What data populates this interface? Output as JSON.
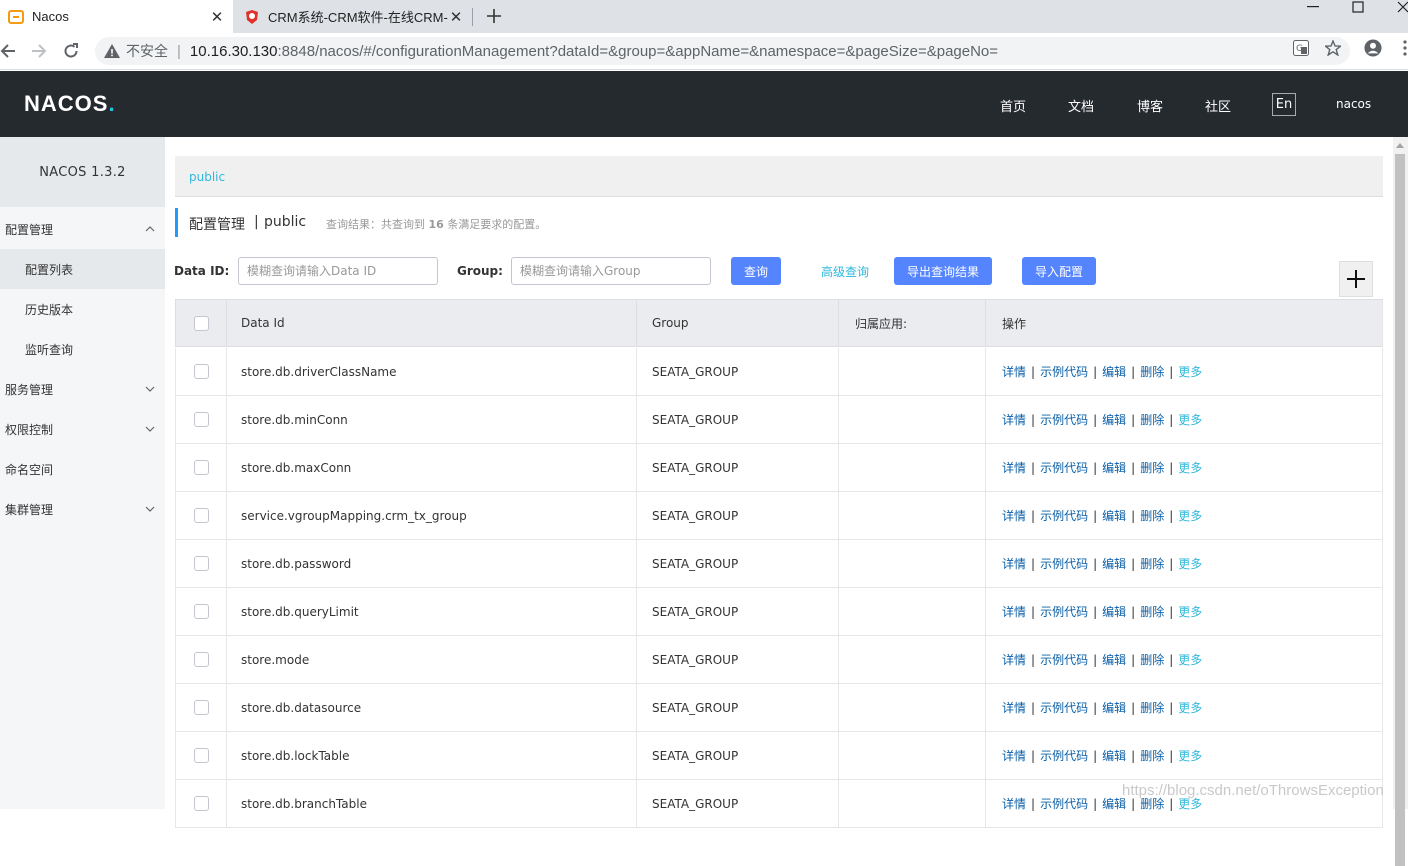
{
  "browser": {
    "tabs": [
      {
        "title": "Nacos",
        "active": true
      },
      {
        "title": "CRM系统-CRM软件-在线CRM-",
        "active": false
      }
    ],
    "address": {
      "security_label": "不安全",
      "host": "10.16.30.130",
      "path": ":8848/nacos/#/configurationManagement?dataId=&group=&appName=&namespace=&pageSize=&pageNo="
    }
  },
  "header": {
    "logo": "NACOS",
    "logo_dot": ".",
    "nav": [
      "首页",
      "文档",
      "博客",
      "社区"
    ],
    "lang": "En",
    "user": "nacos"
  },
  "sidebar": {
    "version": "NACOS 1.3.2",
    "items": [
      {
        "label": "配置管理",
        "level": "top",
        "expanded": true
      },
      {
        "label": "配置列表",
        "level": "sub",
        "selected": true
      },
      {
        "label": "历史版本",
        "level": "sub"
      },
      {
        "label": "监听查询",
        "level": "sub"
      },
      {
        "label": "服务管理",
        "level": "top",
        "expanded": false
      },
      {
        "label": "权限控制",
        "level": "top",
        "expanded": false
      },
      {
        "label": "命名空间",
        "level": "top"
      },
      {
        "label": "集群管理",
        "level": "top",
        "expanded": false
      }
    ]
  },
  "main": {
    "namespace_tab": "public",
    "page_title": "配置管理",
    "title_separator": "|",
    "page_namespace": "public",
    "result_prefix": "查询结果：共查询到",
    "result_count": "16",
    "result_suffix": "条满足要求的配置。",
    "filters": {
      "data_id_label": "Data ID:",
      "data_id_placeholder": "模糊查询请输入Data ID",
      "group_label": "Group:",
      "group_placeholder": "模糊查询请输入Group"
    },
    "buttons": {
      "search": "查询",
      "advanced": "高级查询",
      "export": "导出查询结果",
      "import": "导入配置"
    },
    "table": {
      "columns": [
        "Data Id",
        "Group",
        "归属应用:",
        "操作"
      ],
      "actions": [
        "详情",
        "示例代码",
        "编辑",
        "删除",
        "更多"
      ],
      "rows": [
        {
          "data_id": "store.db.driverClassName",
          "group": "SEATA_GROUP",
          "app": ""
        },
        {
          "data_id": "store.db.minConn",
          "group": "SEATA_GROUP",
          "app": ""
        },
        {
          "data_id": "store.db.maxConn",
          "group": "SEATA_GROUP",
          "app": ""
        },
        {
          "data_id": "service.vgroupMapping.crm_tx_group",
          "group": "SEATA_GROUP",
          "app": ""
        },
        {
          "data_id": "store.db.password",
          "group": "SEATA_GROUP",
          "app": ""
        },
        {
          "data_id": "store.db.queryLimit",
          "group": "SEATA_GROUP",
          "app": ""
        },
        {
          "data_id": "store.mode",
          "group": "SEATA_GROUP",
          "app": ""
        },
        {
          "data_id": "store.db.datasource",
          "group": "SEATA_GROUP",
          "app": ""
        },
        {
          "data_id": "store.db.lockTable",
          "group": "SEATA_GROUP",
          "app": ""
        },
        {
          "data_id": "store.db.branchTable",
          "group": "SEATA_GROUP",
          "app": ""
        }
      ]
    }
  },
  "watermark": "https://blog.csdn.net/oThrowsException",
  "colors": {
    "header_bg": "#252a2f",
    "accent_cyan": "#2eb8dd",
    "primary_button": "#5584ff",
    "action_link": "#0a5fa8",
    "title_bar": "#209bfa"
  }
}
